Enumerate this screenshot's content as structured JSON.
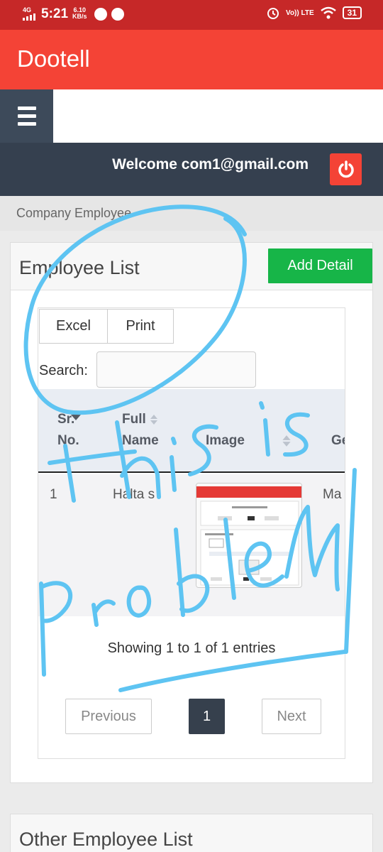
{
  "status_bar": {
    "time": "5:21",
    "network": "4G",
    "speed_value": "6.10",
    "speed_unit": "KB/s",
    "volte": "Vo)) LTE",
    "battery": "31"
  },
  "app": {
    "brand": "Dootell"
  },
  "user_bar": {
    "welcome": "Welcome com1@gmail.com"
  },
  "breadcrumb": "Company Employee",
  "employee_panel": {
    "title": "Employee List",
    "add_button": "Add Detail",
    "export_buttons": {
      "excel": "Excel",
      "print": "Print"
    },
    "search_label": "Search:",
    "search_value": "",
    "columns": [
      {
        "line1": "Sr.",
        "line2": "No."
      },
      {
        "line1": "Full",
        "line2": "Name"
      },
      {
        "line1": "",
        "line2": "Image"
      },
      {
        "line1": "",
        "line2": "Ge"
      }
    ],
    "rows": [
      {
        "sr": "1",
        "name": "Halta s",
        "gender": "Ma"
      }
    ],
    "info": "Showing 1 to 1 of 1 entries",
    "pagination": {
      "previous": "Previous",
      "current": "1",
      "next": "Next"
    }
  },
  "other_panel": {
    "title": "Other Employee List"
  },
  "annotation": {
    "handwriting": "this is problem"
  },
  "colors": {
    "status_bar": "#c62828",
    "app_bar": "#f44336",
    "nav_dark": "#35404f",
    "add_button": "#17b548",
    "annotation": "#5ec4f2"
  }
}
